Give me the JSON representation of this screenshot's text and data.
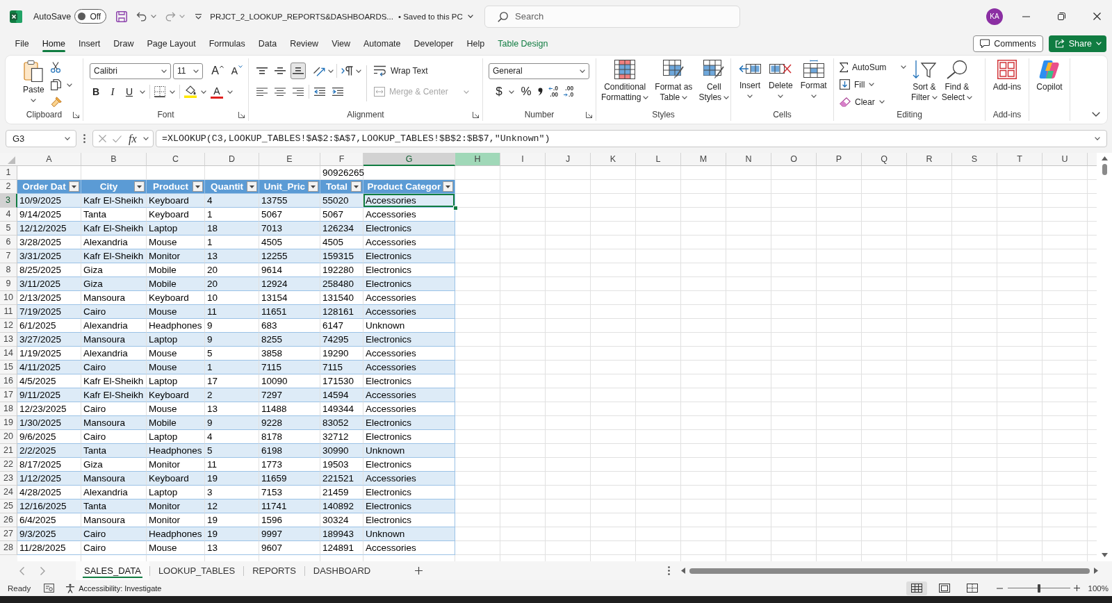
{
  "title_bar": {
    "autosave_label": "AutoSave",
    "autosave": {
      "on": false,
      "state_label": "Off"
    },
    "document_title": "PRJCT_2_LOOKUP_REPORTS&DASHBOARDS...",
    "save_status": "• Saved to this PC",
    "search": {
      "placeholder": "Search"
    },
    "avatar": "KA"
  },
  "menu_tabs": [
    {
      "label": "File",
      "selected": false,
      "kind": "standard"
    },
    {
      "label": "Home",
      "selected": true,
      "kind": "standard"
    },
    {
      "label": "Insert",
      "selected": false,
      "kind": "standard"
    },
    {
      "label": "Draw",
      "selected": false,
      "kind": "standard"
    },
    {
      "label": "Page Layout",
      "selected": false,
      "kind": "standard"
    },
    {
      "label": "Formulas",
      "selected": false,
      "kind": "standard"
    },
    {
      "label": "Data",
      "selected": false,
      "kind": "standard"
    },
    {
      "label": "Review",
      "selected": false,
      "kind": "standard"
    },
    {
      "label": "View",
      "selected": false,
      "kind": "standard"
    },
    {
      "label": "Automate",
      "selected": false,
      "kind": "standard"
    },
    {
      "label": "Developer",
      "selected": false,
      "kind": "standard"
    },
    {
      "label": "Help",
      "selected": false,
      "kind": "standard"
    },
    {
      "label": "Table Design",
      "selected": false,
      "kind": "contextual"
    }
  ],
  "header_buttons": {
    "comments": "Comments",
    "share": "Share"
  },
  "ribbon": {
    "clipboard": {
      "paste": "Paste",
      "group_label": "Clipboard"
    },
    "font": {
      "font_name": "Calibri",
      "font_size": "11",
      "grow": "A",
      "shrink": "A",
      "bold": "B",
      "italic": "I",
      "underline": "U",
      "font_color": "A",
      "group_label": "Font"
    },
    "alignment": {
      "vertical": [
        {
          "kind": "top",
          "selected": false
        },
        {
          "kind": "middle",
          "selected": false
        },
        {
          "kind": "bottom",
          "selected": true
        }
      ],
      "wrap_text": "Wrap Text",
      "merge_center": {
        "label": "Merge & Center",
        "disabled": true
      },
      "group_label": "Alignment"
    },
    "number": {
      "format": "General",
      "currency": "$",
      "percent": "%",
      "increase_decimal": {
        "upper": ".0",
        "lower": ".00"
      },
      "decrease_decimal": {
        "upper": ".00",
        "lower": ".0"
      },
      "group_label": "Number"
    },
    "styles": {
      "buttons": [
        {
          "kind": "conditional",
          "lines": [
            "Conditional",
            "Formatting"
          ]
        },
        {
          "kind": "table",
          "lines": [
            "Format as",
            "Table"
          ]
        },
        {
          "kind": "cell_styles",
          "lines": [
            "Cell",
            "Styles"
          ]
        }
      ],
      "group_label": "Styles"
    },
    "cells": {
      "buttons": [
        {
          "kind": "insert",
          "label": "Insert"
        },
        {
          "kind": "delete",
          "label": "Delete"
        },
        {
          "kind": "format",
          "label": "Format"
        }
      ],
      "group_label": "Cells"
    },
    "editing": {
      "autosum": "AutoSum",
      "fill": "Fill",
      "clear": "Clear",
      "sort_lines": [
        "Sort &",
        "Filter"
      ],
      "find_lines": [
        "Find &",
        "Select"
      ],
      "group_label": "Editing"
    },
    "add_ins": {
      "button": "Add-ins",
      "group_label": "Add-ins"
    },
    "copilot": {
      "button": "Copilot"
    }
  },
  "formula_bar": {
    "name_box": "G3",
    "function_label": "fx",
    "formula": "=XLOOKUP(C3,LOOKUP_TABLES!$A$2:$A$7,LOOKUP_TABLES!$B$2:$B$7,\"Unknown\")"
  },
  "sheet": {
    "columns": [
      {
        "label": "A",
        "selected": false,
        "hovered": false
      },
      {
        "label": "B",
        "selected": false,
        "hovered": false
      },
      {
        "label": "C",
        "selected": false,
        "hovered": false
      },
      {
        "label": "D",
        "selected": false,
        "hovered": false
      },
      {
        "label": "E",
        "selected": false,
        "hovered": false
      },
      {
        "label": "F",
        "selected": false,
        "hovered": false
      },
      {
        "label": "G",
        "selected": true,
        "hovered": false
      },
      {
        "label": "H",
        "selected": false,
        "hovered": true
      },
      {
        "label": "I",
        "selected": false,
        "hovered": false
      },
      {
        "label": "J",
        "selected": false,
        "hovered": false
      },
      {
        "label": "K",
        "selected": false,
        "hovered": false
      },
      {
        "label": "L",
        "selected": false,
        "hovered": false
      },
      {
        "label": "M",
        "selected": false,
        "hovered": false
      },
      {
        "label": "N",
        "selected": false,
        "hovered": false
      },
      {
        "label": "O",
        "selected": false,
        "hovered": false
      },
      {
        "label": "P",
        "selected": false,
        "hovered": false
      },
      {
        "label": "Q",
        "selected": false,
        "hovered": false
      },
      {
        "label": "R",
        "selected": false,
        "hovered": false
      },
      {
        "label": "S",
        "selected": false,
        "hovered": false
      },
      {
        "label": "T",
        "selected": false,
        "hovered": false
      },
      {
        "label": "U",
        "selected": false,
        "hovered": false
      }
    ],
    "row_headers": [
      {
        "label": "1",
        "selected": false
      },
      {
        "label": "2",
        "selected": false
      },
      {
        "label": "3",
        "selected": true
      },
      {
        "label": "4",
        "selected": false
      },
      {
        "label": "5",
        "selected": false
      },
      {
        "label": "6",
        "selected": false
      },
      {
        "label": "7",
        "selected": false
      },
      {
        "label": "8",
        "selected": false
      },
      {
        "label": "9",
        "selected": false
      },
      {
        "label": "10",
        "selected": false
      },
      {
        "label": "11",
        "selected": false
      },
      {
        "label": "12",
        "selected": false
      },
      {
        "label": "13",
        "selected": false
      },
      {
        "label": "14",
        "selected": false
      },
      {
        "label": "15",
        "selected": false
      },
      {
        "label": "16",
        "selected": false
      },
      {
        "label": "17",
        "selected": false
      },
      {
        "label": "18",
        "selected": false
      },
      {
        "label": "19",
        "selected": false
      },
      {
        "label": "20",
        "selected": false
      },
      {
        "label": "21",
        "selected": false
      },
      {
        "label": "22",
        "selected": false
      },
      {
        "label": "23",
        "selected": false
      },
      {
        "label": "24",
        "selected": false
      },
      {
        "label": "25",
        "selected": false
      },
      {
        "label": "26",
        "selected": false
      },
      {
        "label": "27",
        "selected": false
      },
      {
        "label": "28",
        "selected": false
      }
    ],
    "total_cell": "90926265",
    "table": {
      "headers": [
        "Order Dat",
        "City",
        "Product",
        "Quantit",
        "Unit_Pric",
        "Total",
        "Product Categor"
      ],
      "rows": [
        [
          "10/9/2025",
          "Kafr El-Sheikh",
          "Keyboard",
          "4",
          "13755",
          "55020",
          "Accessories"
        ],
        [
          "9/14/2025",
          "Tanta",
          "Keyboard",
          "1",
          "5067",
          "5067",
          "Accessories"
        ],
        [
          "12/12/2025",
          "Kafr El-Sheikh",
          "Laptop",
          "18",
          "7013",
          "126234",
          "Electronics"
        ],
        [
          "3/28/2025",
          "Alexandria",
          "Mouse",
          "1",
          "4505",
          "4505",
          "Accessories"
        ],
        [
          "3/31/2025",
          "Kafr El-Sheikh",
          "Monitor",
          "13",
          "12255",
          "159315",
          "Electronics"
        ],
        [
          "8/25/2025",
          "Giza",
          "Mobile",
          "20",
          "9614",
          "192280",
          "Electronics"
        ],
        [
          "3/11/2025",
          "Giza",
          "Mobile",
          "20",
          "12924",
          "258480",
          "Electronics"
        ],
        [
          "2/13/2025",
          "Mansoura",
          "Keyboard",
          "10",
          "13154",
          "131540",
          "Accessories"
        ],
        [
          "7/19/2025",
          "Cairo",
          "Mouse",
          "11",
          "11651",
          "128161",
          "Accessories"
        ],
        [
          "6/1/2025",
          "Alexandria",
          "Headphones",
          "9",
          "683",
          "6147",
          "Unknown"
        ],
        [
          "3/27/2025",
          "Mansoura",
          "Laptop",
          "9",
          "8255",
          "74295",
          "Electronics"
        ],
        [
          "1/19/2025",
          "Alexandria",
          "Mouse",
          "5",
          "3858",
          "19290",
          "Accessories"
        ],
        [
          "4/11/2025",
          "Cairo",
          "Mouse",
          "1",
          "7115",
          "7115",
          "Accessories"
        ],
        [
          "4/5/2025",
          "Kafr El-Sheikh",
          "Laptop",
          "17",
          "10090",
          "171530",
          "Electronics"
        ],
        [
          "9/11/2025",
          "Kafr El-Sheikh",
          "Keyboard",
          "2",
          "7297",
          "14594",
          "Accessories"
        ],
        [
          "12/23/2025",
          "Cairo",
          "Mouse",
          "13",
          "11488",
          "149344",
          "Accessories"
        ],
        [
          "1/30/2025",
          "Mansoura",
          "Mobile",
          "9",
          "9228",
          "83052",
          "Electronics"
        ],
        [
          "9/6/2025",
          "Cairo",
          "Laptop",
          "4",
          "8178",
          "32712",
          "Electronics"
        ],
        [
          "2/2/2025",
          "Tanta",
          "Headphones",
          "5",
          "6198",
          "30990",
          "Unknown"
        ],
        [
          "8/17/2025",
          "Giza",
          "Monitor",
          "11",
          "1773",
          "19503",
          "Electronics"
        ],
        [
          "1/12/2025",
          "Mansoura",
          "Keyboard",
          "19",
          "11659",
          "221521",
          "Accessories"
        ],
        [
          "4/28/2025",
          "Alexandria",
          "Laptop",
          "3",
          "7153",
          "21459",
          "Electronics"
        ],
        [
          "12/16/2025",
          "Tanta",
          "Monitor",
          "12",
          "11741",
          "140892",
          "Electronics"
        ],
        [
          "6/4/2025",
          "Mansoura",
          "Monitor",
          "19",
          "1596",
          "30324",
          "Electronics"
        ],
        [
          "9/3/2025",
          "Cairo",
          "Headphones",
          "19",
          "9997",
          "189943",
          "Unknown"
        ],
        [
          "11/28/2025",
          "Cairo",
          "Mouse",
          "13",
          "9607",
          "124891",
          "Accessories"
        ]
      ]
    }
  },
  "sheet_tabs": [
    {
      "label": "SALES_DATA",
      "selected": true
    },
    {
      "label": "LOOKUP_TABLES",
      "selected": false
    },
    {
      "label": "REPORTS",
      "selected": false
    },
    {
      "label": "DASHBOARD",
      "selected": false
    }
  ],
  "status_bar": {
    "mode": "Ready",
    "accessibility": "Accessibility: Investigate",
    "view_buttons": [
      {
        "kind": "normal",
        "selected": true
      },
      {
        "kind": "page_layout",
        "selected": false
      },
      {
        "kind": "page_break",
        "selected": false
      }
    ],
    "zoom": {
      "level": 0.5,
      "reading": "100%"
    }
  }
}
